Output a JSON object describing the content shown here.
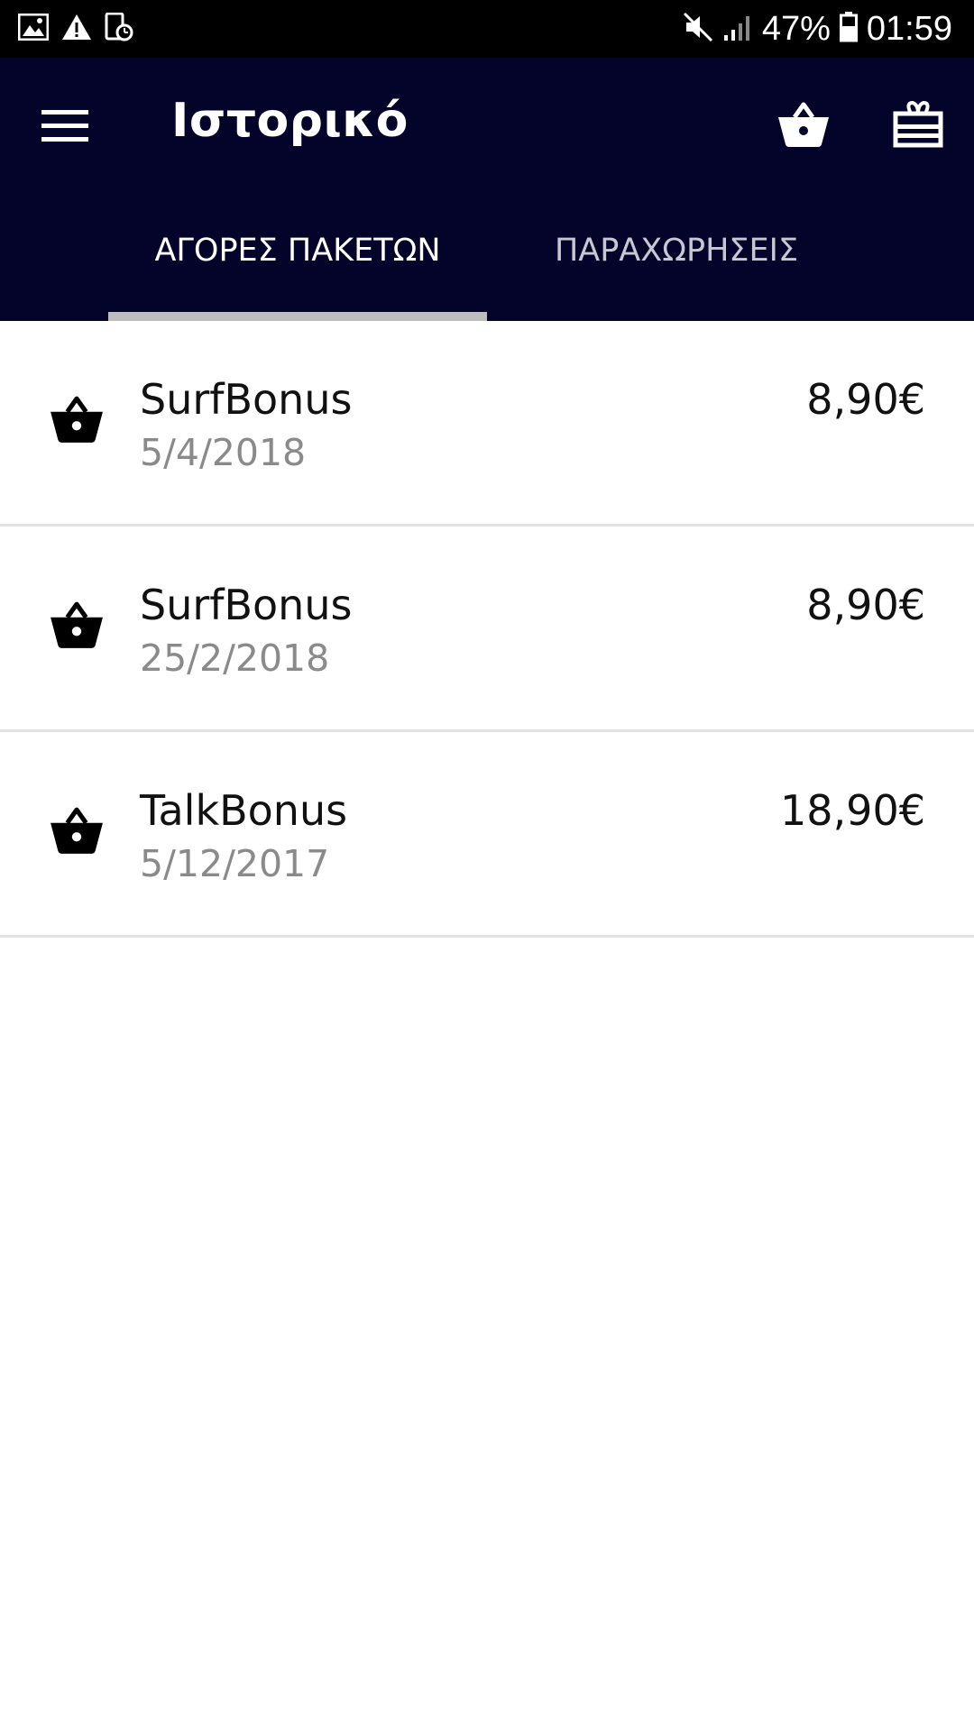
{
  "status_bar": {
    "battery_text": "47%",
    "time": "01:59",
    "icons": [
      "image-icon",
      "warning-icon",
      "screen-timer-icon",
      "mute-icon",
      "signal-icon",
      "battery-icon"
    ]
  },
  "app_bar": {
    "title": "Ιστορικό",
    "menu_icon": "menu-icon",
    "basket_icon": "basket-icon",
    "gift_icon": "gift-icon",
    "background_color": "#04032a"
  },
  "tabs": [
    {
      "label": "ΑΓΟΡΕΣ ΠΑΚΕΤΩΝ",
      "selected": true
    },
    {
      "label": "ΠΑΡΑΧΩΡΗΣΕΙΣ",
      "selected": false
    }
  ],
  "purchases": [
    {
      "name": "SurfBonus",
      "date": "5/4/2018",
      "price": "8,90€",
      "icon": "basket-icon"
    },
    {
      "name": "SurfBonus",
      "date": "25/2/2018",
      "price": "8,90€",
      "icon": "basket-icon"
    },
    {
      "name": "TalkBonus",
      "date": "5/12/2017",
      "price": "18,90€",
      "icon": "basket-icon"
    }
  ]
}
